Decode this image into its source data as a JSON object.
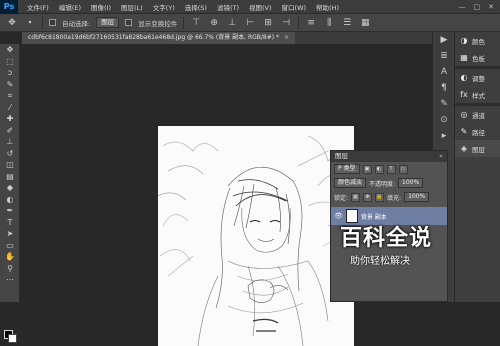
{
  "app": {
    "logo": "Ps"
  },
  "menu": [
    "文件(F)",
    "编辑(E)",
    "图像(I)",
    "图层(L)",
    "文字(Y)",
    "选择(S)",
    "滤镜(T)",
    "视图(V)",
    "窗口(W)",
    "帮助(H)"
  ],
  "window_controls": [
    "—",
    "□",
    "✕"
  ],
  "options": {
    "auto_select_label": "自动选择:",
    "auto_select_value": "图层",
    "show_transform_label": "显示变换控件"
  },
  "document_tab": {
    "title": "cdbf6c81800a19d6bf27160531fa828ba61e468d.jpg @ 66.7% (背景 副本, RGB/8#) *",
    "close": "×"
  },
  "right_panels": [
    {
      "icon": "color-icon",
      "label": "颜色"
    },
    {
      "icon": "swatches-icon",
      "label": "色板"
    },
    {
      "icon": "adjust-icon",
      "label": "调整"
    },
    {
      "icon": "styles-icon",
      "label": "样式"
    },
    {
      "icon": "channels-icon",
      "label": "通道"
    },
    {
      "icon": "paths-icon",
      "label": "路径"
    },
    {
      "icon": "layers-icon",
      "label": "图层"
    }
  ],
  "layers": {
    "title": "图层",
    "filter_label": "P 类型",
    "blend_mode": "颜色减淡",
    "opacity_label": "不透明度:",
    "opacity_value": "100%",
    "lock_label": "锁定:",
    "fill_label": "填充:",
    "fill_value": "100%",
    "active_layer": "背景 副本"
  },
  "watermark": {
    "title": "百科全说",
    "subtitle": "助你轻松解决"
  },
  "colors": {
    "accent": "#31a8ff",
    "layer_selected": "#6f7ea3",
    "watermark_red": "#e31a1a"
  }
}
